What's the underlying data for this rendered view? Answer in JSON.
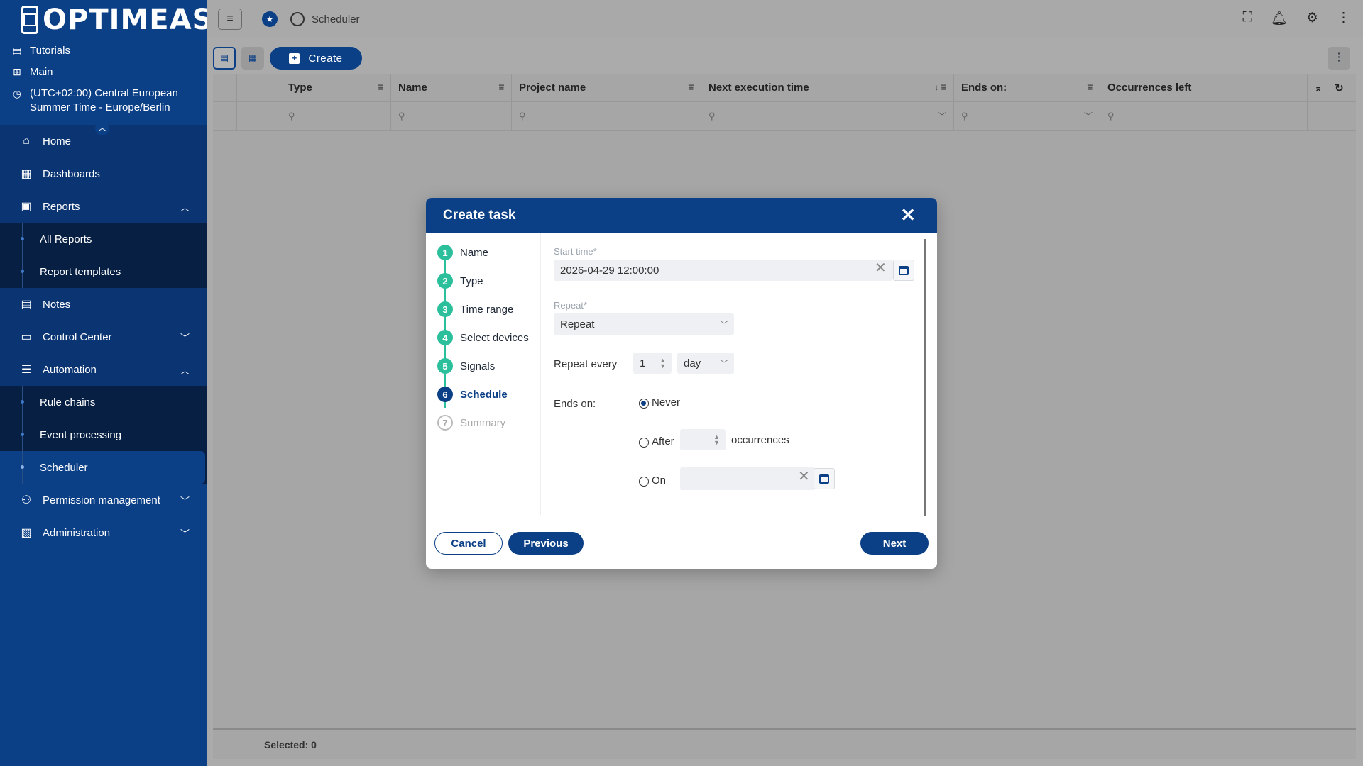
{
  "app": {
    "logo_text": "OPTIMEAS",
    "tutorials": "Tutorials",
    "main": "Main",
    "timezone": "(UTC+02:00) Central European Summer Time - Europe/Berlin"
  },
  "sidebar": {
    "items": [
      {
        "label": "Home",
        "icon": "home-icon"
      },
      {
        "label": "Dashboards",
        "icon": "dashboard-icon"
      },
      {
        "label": "Reports",
        "icon": "clipboard-icon",
        "expanded": true
      },
      {
        "label": "Notes",
        "icon": "document-icon"
      },
      {
        "label": "Control Center",
        "icon": "devices-icon",
        "expanded": false
      },
      {
        "label": "Automation",
        "icon": "sliders-icon",
        "expanded": true
      },
      {
        "label": "Permission management",
        "icon": "users-icon",
        "expanded": false
      },
      {
        "label": "Administration",
        "icon": "admin-icon",
        "expanded": false
      }
    ],
    "reports_sub": [
      "All Reports",
      "Report templates"
    ],
    "automation_sub": [
      "Rule chains",
      "Event processing",
      "Scheduler"
    ]
  },
  "topbar": {
    "breadcrumb": "Scheduler"
  },
  "toolbar": {
    "create_label": "Create"
  },
  "grid": {
    "columns": [
      "Type",
      "Name",
      "Project name",
      "Next execution time",
      "Ends on:",
      "Occurrences left"
    ],
    "footer": "Selected: 0"
  },
  "modal": {
    "title": "Create task",
    "steps": [
      "Name",
      "Type",
      "Time range",
      "Select devices",
      "Signals",
      "Schedule",
      "Summary"
    ],
    "step_numbers": [
      "1",
      "2",
      "3",
      "4",
      "5",
      "6",
      "7"
    ],
    "current_step": 6,
    "start_time_label": "Start time*",
    "start_time_value": "2026-04-29 12:00:00",
    "repeat_label": "Repeat*",
    "repeat_value": "Repeat",
    "repeat_every_label": "Repeat every",
    "repeat_every_value": "1",
    "repeat_unit": "day",
    "ends_on_label": "Ends on:",
    "ends_never": "Never",
    "ends_after": "After",
    "occurrences": "occurrences",
    "ends_on": "On",
    "ends_selected": "Never",
    "cancel": "Cancel",
    "previous": "Previous",
    "next": "Next"
  },
  "colors": {
    "brand": "#0b3f86",
    "step_done": "#2bbf9c"
  }
}
